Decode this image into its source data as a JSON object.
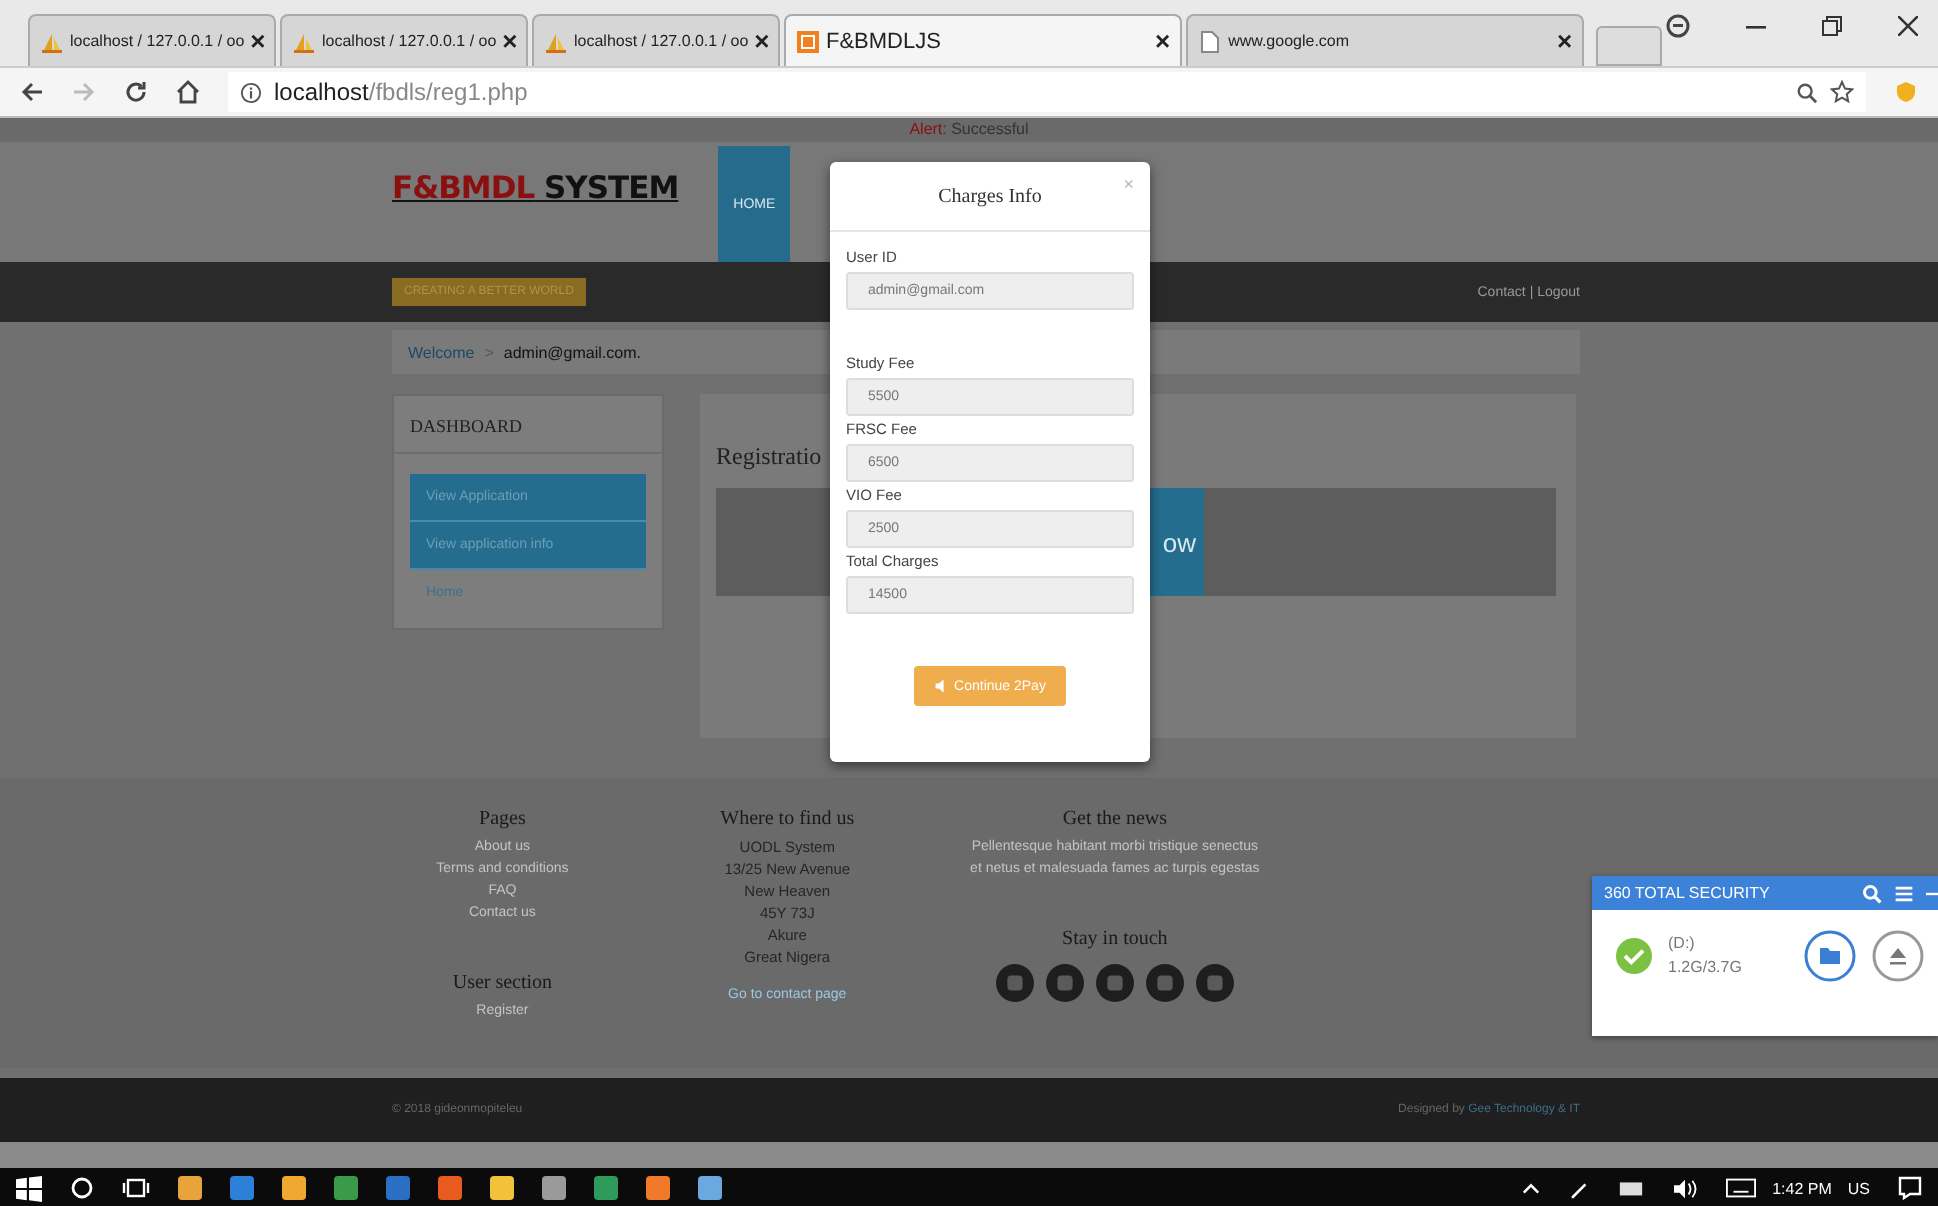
{
  "browser": {
    "tabs": [
      {
        "title": "localhost / 127.0.0.1 / oo",
        "selected": false,
        "kind": "db"
      },
      {
        "title": "localhost / 127.0.0.1 / oo",
        "selected": false,
        "kind": "db"
      },
      {
        "title": "localhost / 127.0.0.1 / oo",
        "selected": false,
        "kind": "db"
      },
      {
        "title": "F&BMDLJS",
        "selected": true,
        "kind": "site"
      },
      {
        "title": "www.google.com",
        "selected": false,
        "kind": "page"
      }
    ],
    "close": "×",
    "address": {
      "host": "localhost",
      "path": "/fbdls/reg1.php"
    }
  },
  "alert": {
    "label": "Alert:",
    "text": "Successful"
  },
  "header": {
    "logo_main": "F&BMDL",
    "logo_rest": "SYSTEM",
    "nav": "HOME"
  },
  "navbar": {
    "badge": "CREATING A BETTER WORLD",
    "links": "Contact | Logout"
  },
  "breadcrumb": {
    "link": "Welcome",
    "sep": ">",
    "user": "admin@gmail.com."
  },
  "dashboard": {
    "title": "DASHBOARD",
    "items": [
      {
        "label": "View Application",
        "kind": "button"
      },
      {
        "label": "View application info",
        "kind": "button"
      },
      {
        "label": "Home",
        "kind": "link"
      }
    ]
  },
  "registration": {
    "title": "Registratio",
    "button": "ow"
  },
  "modal": {
    "title": "Charges Info",
    "close": "×",
    "fields": [
      {
        "label": "User ID",
        "value": "admin@gmail.com"
      },
      {
        "label": "Study Fee",
        "value": "5500"
      },
      {
        "label": "FRSC Fee",
        "value": "6500"
      },
      {
        "label": "VIO Fee",
        "value": "2500"
      },
      {
        "label": "Total Charges",
        "value": "14500"
      }
    ],
    "button": "Continue 2Pay"
  },
  "footer": {
    "pages": {
      "title": "Pages",
      "links": [
        "About us",
        "Terms and conditions",
        "FAQ",
        "Contact us"
      ]
    },
    "user_section": {
      "title": "User section",
      "links": [
        "Register"
      ]
    },
    "where": {
      "title": "Where to find us",
      "lines": [
        "UODL System",
        "13/25 New Avenue",
        "New Heaven",
        "45Y 73J",
        "Akure",
        "Great Nigera"
      ],
      "link": "Go to contact page"
    },
    "news": {
      "title": "Get the news",
      "text": "Pellentesque habitant morbi tristique senectus et netus et malesuada fames ac turpis egestas",
      "touch": "Stay in touch"
    }
  },
  "bottom": {
    "copyright": "© 2018 gideonmopiteleu",
    "designed": "Designed by",
    "company": "Gee Technology & IT"
  },
  "widget": {
    "title": "360 TOTAL SECURITY",
    "drive": "(D:)",
    "usage": "1.2G/3.7G"
  },
  "taskbar": {
    "time": "1:42 PM",
    "lang": "US"
  }
}
